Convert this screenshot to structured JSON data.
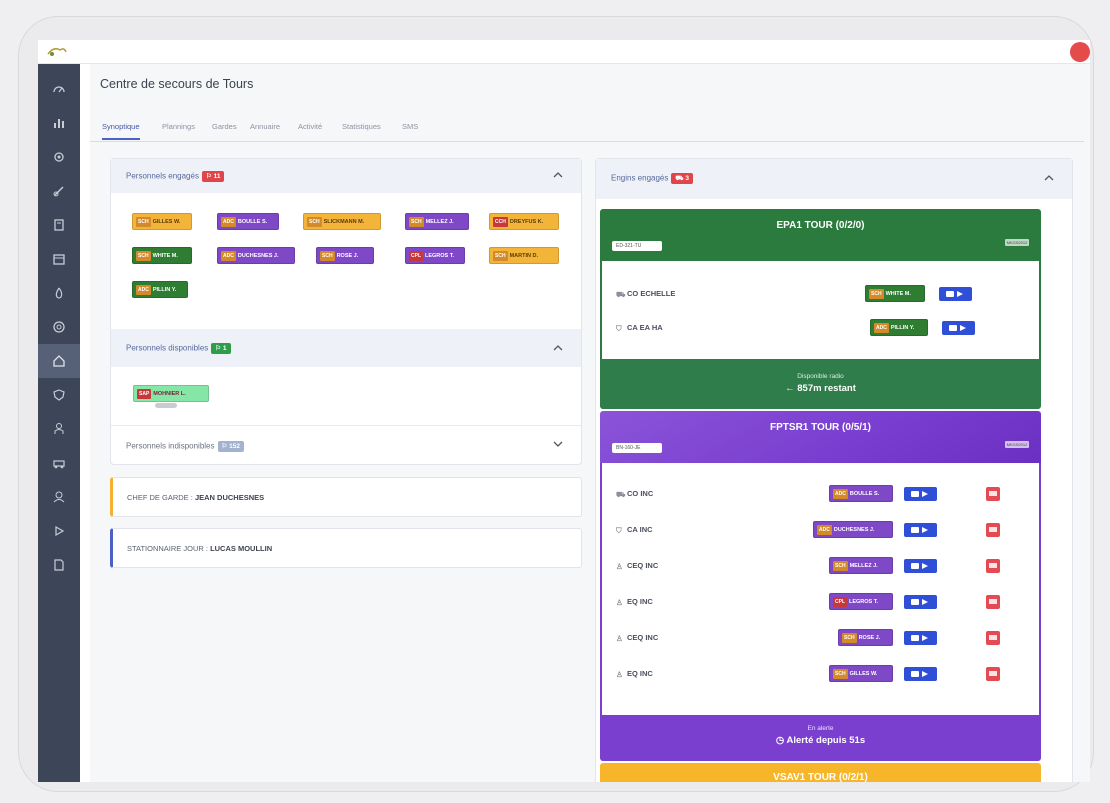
{
  "app": {
    "title": "Centre de secours de Tours"
  },
  "tabs": [
    "Synoptique",
    "Plannings",
    "Gardes",
    "Annuaire",
    "Activité",
    "Statistiques",
    "SMS"
  ],
  "colors": {
    "sidebar": "#3c4658",
    "accent": "#4a61c8",
    "green": "#2e7d32",
    "purple": "#7b3fd0",
    "orange": "#f7b52a",
    "danger": "#e34a53",
    "send": "#2f4fd6"
  },
  "sidebar_icons": [
    "dashboard-icon",
    "chart-icon",
    "settings-icon",
    "link-icon",
    "book-icon",
    "calendar-icon",
    "fire-icon",
    "help-icon",
    "home-icon",
    "shield-icon",
    "person-icon",
    "truck-icon",
    "users-icon",
    "play-icon",
    "document-icon"
  ],
  "personnel": {
    "engaged": {
      "label": "Personnels engagés",
      "count": "11"
    },
    "available": {
      "label": "Personnels disponibles",
      "count": "1"
    },
    "unavailable": {
      "label": "Personnels indisponibles",
      "count": "152"
    },
    "engaged_chips": [
      {
        "rank": "SCH",
        "name": "GILLES W."
      },
      {
        "rank": "ADC",
        "name": "BOULLE S."
      },
      {
        "rank": "SCH",
        "name": "SLICKMANN M."
      },
      {
        "rank": "SCH",
        "name": "MELLEZ J."
      },
      {
        "rank": "CCH",
        "name": "DREYFUS K."
      },
      {
        "rank": "SCH",
        "name": "WHITE M."
      },
      {
        "rank": "ADC",
        "name": "DUCHESNES J."
      },
      {
        "rank": "SCH",
        "name": "ROSE J."
      },
      {
        "rank": "CPL",
        "name": "LEGROS T."
      },
      {
        "rank": "SCH",
        "name": "MARTIN D."
      },
      {
        "rank": "ADC",
        "name": "PILLIN Y."
      }
    ],
    "available_chips": [
      {
        "rank": "SAP",
        "name": "MOHNIER L."
      }
    ]
  },
  "chef_garde": {
    "label": "CHEF DE GARDE : ",
    "value": "JEAN DUCHESNES"
  },
  "stationnaire": {
    "label": "STATIONNAIRE JOUR : ",
    "value": "LUCAS MOULLIN"
  },
  "engins": {
    "label": "Engins engagés",
    "count": "3",
    "list": [
      {
        "title": "EPA1 TOUR (0/2/0)",
        "plate": "ED-321-TU",
        "code": "MKGS2012",
        "rows": [
          {
            "role": "CO ECHELLE",
            "chip": {
              "rank": "SCH",
              "name": "WHITE M."
            }
          },
          {
            "role": "CA EA HA",
            "chip": {
              "rank": "ADC",
              "name": "PILLIN Y."
            }
          }
        ],
        "foot_small": "Disponible radio",
        "foot_big": "← 857m restant"
      },
      {
        "title": "FPTSR1 TOUR (0/5/1)",
        "plate": "BN-160-JE",
        "code": "MKGS2012",
        "rows": [
          {
            "role": "CO INC",
            "chip": {
              "rank": "ADC",
              "name": "BOULLE S."
            }
          },
          {
            "role": "CA INC",
            "chip": {
              "rank": "ADC",
              "name": "DUCHESNES J."
            }
          },
          {
            "role": "CEQ INC",
            "chip": {
              "rank": "SCH",
              "name": "MELLEZ J."
            }
          },
          {
            "role": "EQ INC",
            "chip": {
              "rank": "CPL",
              "name": "LEGROS T."
            }
          },
          {
            "role": "CEQ INC",
            "chip": {
              "rank": "SCH",
              "name": "ROSE J."
            }
          },
          {
            "role": "EQ INC",
            "chip": {
              "rank": "SCH",
              "name": "GILLES W."
            }
          }
        ],
        "foot_small": "En alerte",
        "foot_big": "Alerté depuis 51s"
      },
      {
        "title": "VSAV1 TOUR (0/2/1)"
      }
    ]
  }
}
